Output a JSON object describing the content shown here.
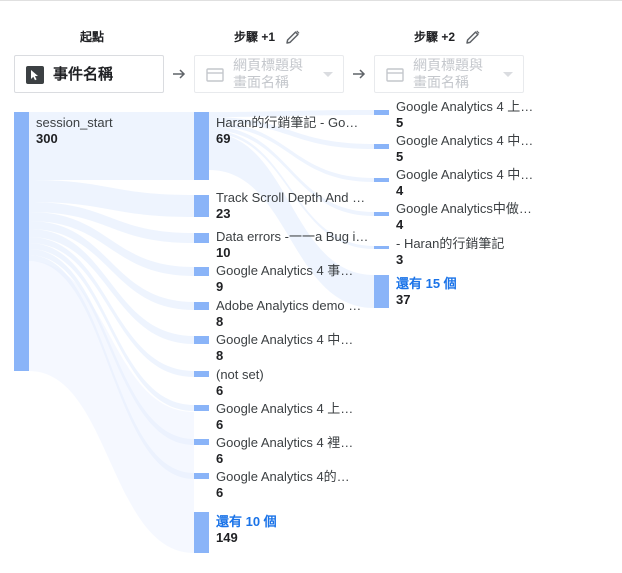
{
  "headers": {
    "start": "起點",
    "step1": "步驟 +1",
    "step2": "步驟 +2"
  },
  "selectors": {
    "start": {
      "label": "事件名稱",
      "icon": "cursor-icon"
    },
    "step1": {
      "label_line1": "網頁標題與",
      "label_line2": "畫面名稱",
      "icon": "screen-icon"
    },
    "step2": {
      "label_line1": "網頁標題與",
      "label_line2": "畫面名稱",
      "icon": "screen-icon"
    }
  },
  "start_node": {
    "label": "session_start",
    "value": "300"
  },
  "step1_nodes": [
    {
      "label": "Haran的行銷筆記 - Go…",
      "value": "69"
    },
    {
      "label": "Track Scroll Depth And …",
      "value": "23"
    },
    {
      "label": "Data errors -一一a Bug i…",
      "value": "10"
    },
    {
      "label": "Google Analytics 4 事…",
      "value": "9"
    },
    {
      "label": "Adobe Analytics demo …",
      "value": "8"
    },
    {
      "label": "Google Analytics 4 中…",
      "value": "8"
    },
    {
      "label": "(not set)",
      "value": "6"
    },
    {
      "label": "Google Analytics 4 上…",
      "value": "6"
    },
    {
      "label": "Google Analytics 4 裡…",
      "value": "6"
    },
    {
      "label": "Google Analytics 4的…",
      "value": "6"
    }
  ],
  "step1_more": {
    "label": "還有 10 個",
    "value": "149"
  },
  "step2_nodes": [
    {
      "label": "Google Analytics 4 上…",
      "value": "5"
    },
    {
      "label": "Google Analytics 4 中…",
      "value": "5"
    },
    {
      "label": "Google Analytics 4 中…",
      "value": "4"
    },
    {
      "label": "Google Analytics中做…",
      "value": "4"
    },
    {
      "label": "- Haran的行銷筆記",
      "value": "3"
    }
  ],
  "step2_more": {
    "label": "還有 15 個",
    "value": "37"
  },
  "colors": {
    "bar": "#8ab4f8",
    "flow": "#e8f0fe",
    "link": "#1a73e8"
  }
}
